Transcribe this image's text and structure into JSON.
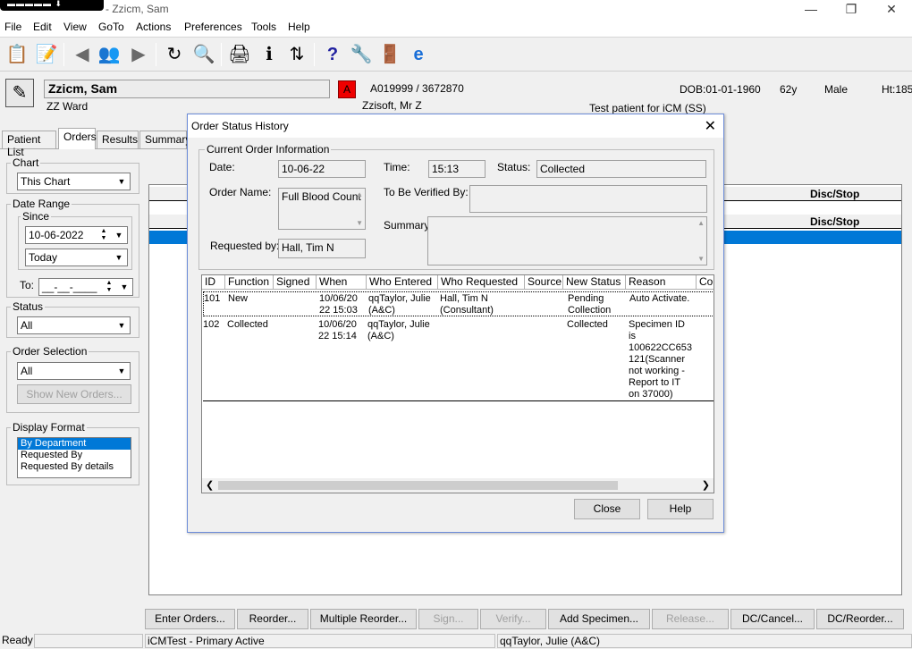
{
  "window": {
    "title": "- Zzicm, Sam",
    "logo_text": "▬▬▬▬▬ ⬇ ▬▬▬▬▬"
  },
  "menu": [
    "File",
    "Edit",
    "View",
    "GoTo",
    "Actions",
    "Preferences",
    "Tools",
    "Help"
  ],
  "patient": {
    "name": "Zzicm, Sam",
    "ward": "ZZ Ward",
    "alert": "A",
    "ids": "A019999 / 3672870",
    "consultant": "Zzisoft, Mr Z",
    "dob": "DOB:01-01-1960",
    "age": "62y",
    "sex": "Male",
    "height": "Ht:185",
    "note": "Test patient for iCM (SS)"
  },
  "tabs": [
    "Patient List",
    "Orders",
    "Results",
    "Summary"
  ],
  "left_panel": {
    "chart_label": "Chart",
    "chart_value": "This Chart",
    "date_range_label": "Date Range",
    "since_label": "Since",
    "since_date": "10-06-2022",
    "since_preset": "Today",
    "to_label": "To:",
    "to_value": "__-__-____",
    "status_label": "Status",
    "status_value": "All",
    "order_selection_label": "Order Selection",
    "order_selection_value": "All",
    "show_new_orders": "Show New Orders...",
    "display_format_label": "Display Format",
    "display_format_options": [
      "By Department",
      "Requested By",
      "Requested By details"
    ]
  },
  "main": {
    "col_disc_stop_1": "Disc/Stop",
    "col_disc_stop_2": "Disc/Stop"
  },
  "dialog": {
    "title": "Order Status History",
    "section": "Current Order Information",
    "date_label": "Date:",
    "date_value": "10-06-22",
    "time_label": "Time:",
    "time_value": "15:13",
    "status_label": "Status:",
    "status_value": "Collected",
    "order_name_label": "Order Name:",
    "order_name_value": "Full Blood Count",
    "verified_label": "To Be Verified By:",
    "verified_value": "",
    "summary_label": "Summary:",
    "summary_value": "",
    "requested_label": "Requested by:",
    "requested_value": "Hall, Tim N",
    "columns": [
      "ID",
      "Function",
      "Signed",
      "When",
      "Who Entered",
      "Who Requested",
      "Source",
      "New Status",
      "Reason",
      "Cor"
    ],
    "rows": [
      {
        "id": "101",
        "function": "New",
        "signed": "",
        "when": "10/06/20\n22 15:03",
        "who_entered": "qqTaylor, Julie\n(A&C)",
        "who_requested": "Hall, Tim N\n(Consultant)",
        "source": "",
        "new_status": "Pending\nCollection",
        "reason": "Auto Activate."
      },
      {
        "id": "102",
        "function": "Collected",
        "signed": "",
        "when": "10/06/20\n22 15:14",
        "who_entered": "qqTaylor, Julie\n(A&C)",
        "who_requested": "",
        "source": "",
        "new_status": "Collected",
        "reason": "Specimen ID\nis\n100622CC653\n121(Scanner\nnot working -\nReport to IT\non 37000)"
      }
    ],
    "close_button": "Close",
    "help_button": "Help"
  },
  "bottom_buttons": [
    {
      "label": "Enter Orders...",
      "enabled": true
    },
    {
      "label": "Reorder...",
      "enabled": true
    },
    {
      "label": "Multiple Reorder...",
      "enabled": true
    },
    {
      "label": "Sign...",
      "enabled": false
    },
    {
      "label": "Verify...",
      "enabled": false
    },
    {
      "label": "Add Specimen...",
      "enabled": true
    },
    {
      "label": "Release...",
      "enabled": false
    },
    {
      "label": "DC/Cancel...",
      "enabled": true
    },
    {
      "label": "DC/Reorder...",
      "enabled": true
    }
  ],
  "statusbar": {
    "ready": "Ready",
    "system": "iCMTest - Primary Active",
    "user": "qqTaylor, Julie  (A&C)"
  },
  "colors": {
    "selection": "#0078d7",
    "alert": "#ee0000"
  }
}
